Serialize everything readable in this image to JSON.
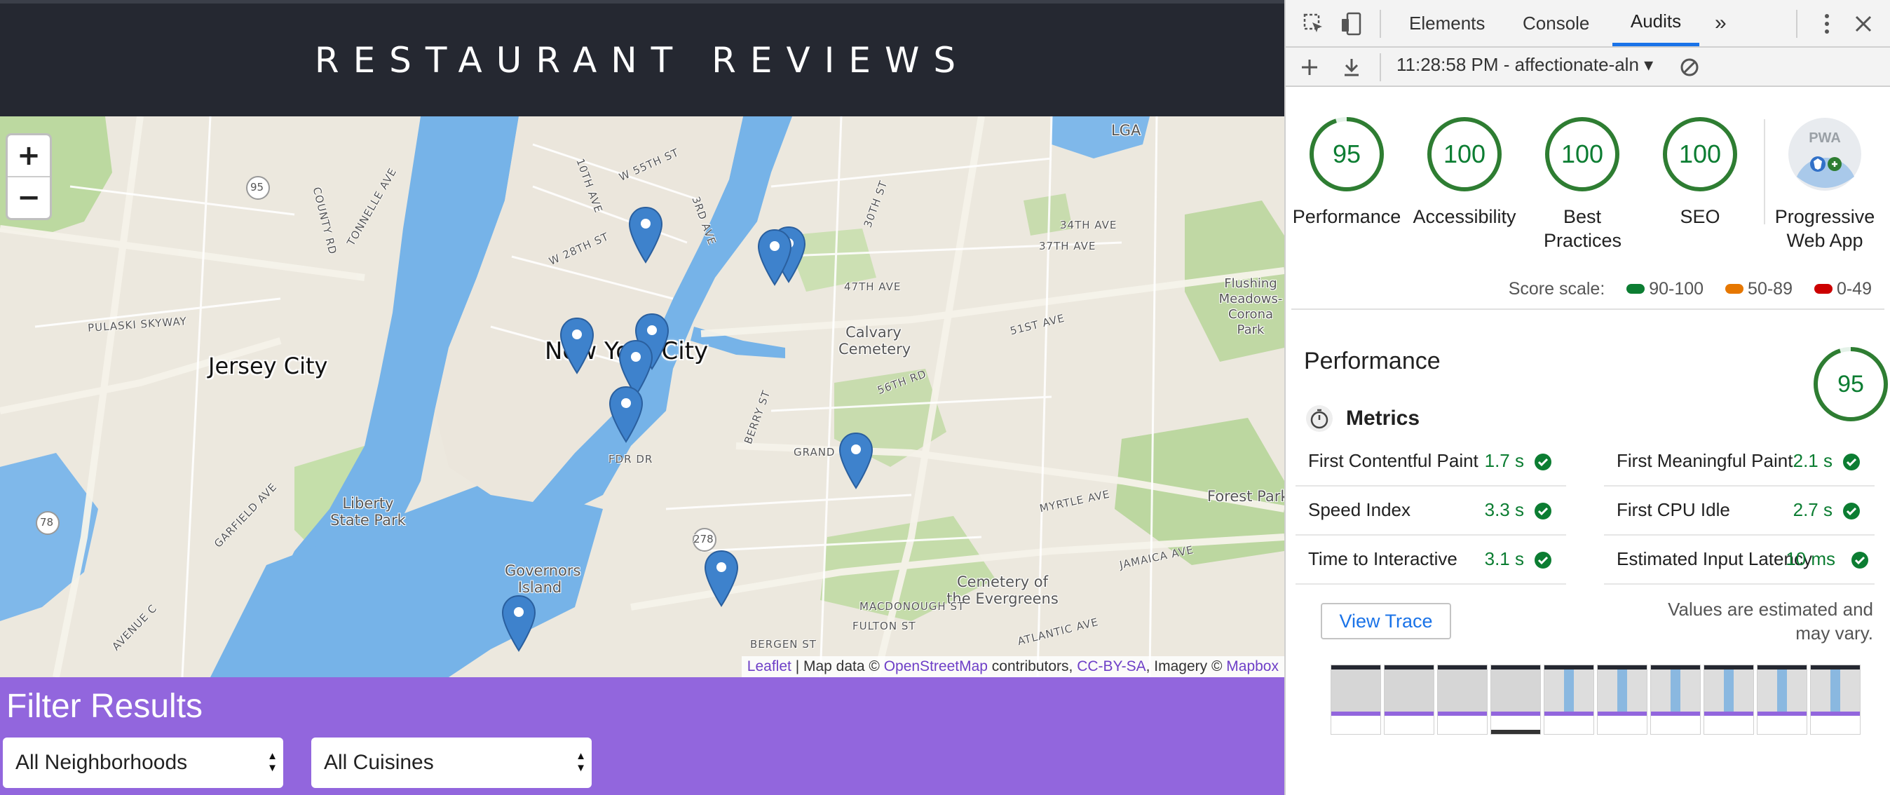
{
  "app": {
    "title": "RESTAURANT REVIEWS",
    "map": {
      "zoom_in": "+",
      "zoom_out": "−",
      "labels": {
        "new_york_city": "New York City",
        "jersey_city": "Jersey City",
        "calvary_cemetery": "Calvary Cemetery",
        "liberty_state_park": "Liberty State Park",
        "governors_island": "Governors Island",
        "cemetery_evergreens": "Cemetery of the Evergreens",
        "forest_park": "Forest Park",
        "flushing_meadows": "Flushing Meadows-Corona Park",
        "lga": "LGA",
        "pulaski_skyway": "PULASKI SKYWAY",
        "fdr_dr": "FDR DR",
        "w_55th_st": "W 55TH ST",
        "47th_ave": "47TH AVE",
        "51st_ave": "51ST AVE",
        "myrtle_ave": "MYRTLE AVE",
        "atlantic_ave": "ATLANTIC AVE",
        "jamaica_ave": "JAMAICA AVE",
        "grand_st": "GRAND",
        "10th_ave": "10TH AVE",
        "3rd_ave": "3RD AVE",
        "w_28th_st": "W 28TH ST",
        "garfield_ave": "GARFIELD AVE",
        "avenue_c": "AVENUE C",
        "berry_st": "BERRY ST",
        "56th_rd": "56TH RD",
        "34th_ave": "34TH AVE",
        "37th_ave": "37TH AVE",
        "30th_st": "30TH ST",
        "county_rd": "COUNTY RD",
        "tonnelle_ave": "TONNELLE AVE",
        "bergen_st": "BERGEN ST",
        "fulton_st": "FULTON ST",
        "macdonough_st": "MACDONOUGH ST",
        "route_95": "95",
        "route_78": "78",
        "route_278": "278"
      },
      "attribution": {
        "leaflet": "Leaflet",
        "map_data": " | Map data © ",
        "osm": "OpenStreetMap",
        "contributors": " contributors, ",
        "license": "CC-BY-SA",
        "imagery": ", Imagery © ",
        "mapbox": "Mapbox"
      }
    },
    "filter": {
      "title": "Filter Results",
      "neighborhood": "All Neighborhoods",
      "cuisine": "All Cuisines"
    }
  },
  "devtools": {
    "tabs": [
      "Elements",
      "Console",
      "Audits"
    ],
    "active_tab": "Audits",
    "more_tabs": "»",
    "report": "11:28:58 PM - affectionate-aln ▾",
    "categories": [
      {
        "label": "Performance",
        "score": "95"
      },
      {
        "label": "Accessibility",
        "score": "100"
      },
      {
        "label": "Best Practices",
        "score": "100"
      },
      {
        "label": "SEO",
        "score": "100"
      },
      {
        "label": "Progressive Web App",
        "score": ""
      }
    ],
    "pwa_badge": "PWA",
    "score_scale": {
      "label": "Score scale:",
      "pass": "90-100",
      "average": "50-89",
      "fail": "0-49",
      "colors": {
        "pass": "#0c7d32",
        "average": "#e67700",
        "fail": "#cc0000"
      }
    },
    "performance": {
      "title": "Performance",
      "score": "95",
      "metrics_title": "Metrics",
      "metrics": [
        {
          "name": "First Contentful Paint",
          "value": "1.7 s"
        },
        {
          "name": "First Meaningful Paint",
          "value": "2.1 s"
        },
        {
          "name": "Speed Index",
          "value": "3.3 s"
        },
        {
          "name": "First CPU Idle",
          "value": "2.7 s"
        },
        {
          "name": "Time to Interactive",
          "value": "3.1 s"
        },
        {
          "name": "Estimated Input Latency",
          "value": "10 ms"
        }
      ],
      "view_trace": "View Trace",
      "note": "Values are estimated and may vary."
    }
  }
}
